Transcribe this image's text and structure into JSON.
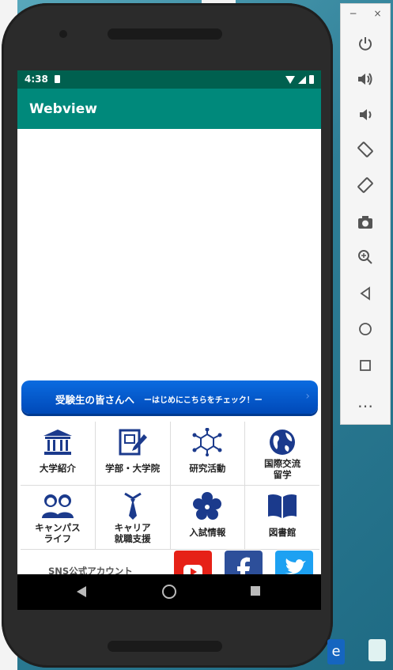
{
  "status_bar": {
    "time": "4:38"
  },
  "app_bar": {
    "title": "Webview"
  },
  "banner": {
    "main": "受験生の皆さんへ",
    "sub": "ーはじめにこちらをチェック！ー",
    "chevron": "›"
  },
  "grid": {
    "items": [
      {
        "label1": "大学紹介",
        "label2": "",
        "icon": "university-building-icon"
      },
      {
        "label1": "学部・大学院",
        "label2": "",
        "icon": "faculty-pencil-icon"
      },
      {
        "label1": "研究活動",
        "label2": "",
        "icon": "molecule-network-icon"
      },
      {
        "label1": "国際交流",
        "label2": "留学",
        "icon": "globe-icon"
      },
      {
        "label1": "キャンパス",
        "label2": "ライフ",
        "icon": "students-icon"
      },
      {
        "label1": "キャリア",
        "label2": "就職支援",
        "icon": "career-tie-icon"
      },
      {
        "label1": "入試情報",
        "label2": "",
        "icon": "flower-crest-icon"
      },
      {
        "label1": "図書館",
        "label2": "",
        "icon": "book-icon"
      }
    ]
  },
  "sns": {
    "label": "SNS公式アカウント",
    "buttons": [
      "youtube-icon",
      "facebook-icon",
      "twitter-icon"
    ]
  },
  "colors": {
    "accent": "#00897b",
    "status": "#00604f",
    "banner": "#0a6be0",
    "icon_blue": "#1b3a8c"
  },
  "emulator_panel": {
    "minimize": "−",
    "close": "×",
    "more": "…"
  }
}
